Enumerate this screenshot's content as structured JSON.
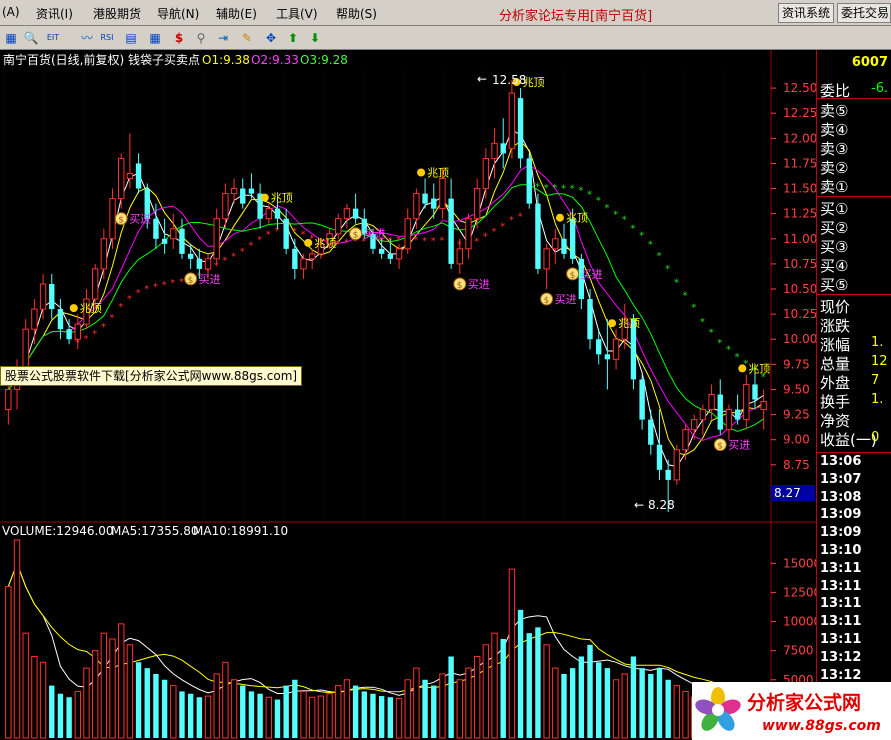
{
  "menu": {
    "items": [
      "(A)",
      "资讯(I)",
      "港股期货",
      "导航(N)",
      "辅助(E)",
      "工具(V)",
      "帮助(S)"
    ],
    "brand": "分析家论坛专用",
    "stock_tag": "[南宁百货]",
    "btn_info": "资讯系统",
    "btn_order": "委托交易"
  },
  "toolbar": {
    "icons": [
      "chart-icon",
      "zoom-icon",
      "eit-icon",
      "wave-icon",
      "rsi-icon",
      "grid-icon",
      "dollar-icon",
      "link-icon",
      "arrow-in-icon",
      "pencil-icon",
      "move-icon",
      "up-arrow-icon",
      "down-arrow-icon"
    ]
  },
  "chart_header": {
    "title": "南宁百货(日线,前复权) 钱袋子买卖点",
    "o1": "O1:9.38",
    "o2": "O2:9.33",
    "o3": "O3:9.28"
  },
  "volume_header": {
    "volume": "VOLUME:12946.00",
    "ma5": "MA5:17355.80",
    "ma10": "MA10:18991.10"
  },
  "annotations": {
    "high": "12.58",
    "low": "8.28",
    "last_price_tag": "8.27",
    "top_label": "兆顶",
    "buy_label": "买进"
  },
  "watermark": "股票公式股票软件下载[分析家公式网www.88gs.com]",
  "right_panel": {
    "code": "6007",
    "wei_bi": "委比",
    "wei_bi_val": "-6.",
    "sells": [
      "卖⑤",
      "卖④",
      "卖③",
      "卖②",
      "卖①"
    ],
    "buys": [
      "买①",
      "买②",
      "买③",
      "买④",
      "买⑤"
    ],
    "stats": [
      {
        "label": "现价",
        "val": ""
      },
      {
        "label": "涨跌",
        "val": ""
      },
      {
        "label": "涨幅",
        "val": "1."
      },
      {
        "label": "总量",
        "val": "12"
      },
      {
        "label": "外盘",
        "val": "7"
      },
      {
        "label": "换手",
        "val": "1."
      },
      {
        "label": "净资",
        "val": ""
      },
      {
        "label": "收益(一)",
        "val": "0"
      }
    ],
    "times": [
      "13:06",
      "13:07",
      "13:08",
      "13:09",
      "13:09",
      "13:10",
      "13:11",
      "13:11",
      "13:11",
      "13:11",
      "13:11",
      "13:12",
      "13:12"
    ]
  },
  "logo": {
    "text": "分析家公式网",
    "url": "www.88gs.com"
  },
  "colors": {
    "up": "#ff3030",
    "down": "#54ffff",
    "ma_white": "#ffffff",
    "ma_yellow": "#ffff00",
    "ma_magenta": "#ff00ff",
    "ma_green": "#00ff00",
    "grid": "#a00000",
    "axis_text": "#ff4040"
  },
  "chart_data": {
    "type": "candlestick",
    "price_axis": {
      "ticks": [
        12.5,
        12.25,
        12.0,
        11.75,
        11.5,
        11.25,
        11.0,
        10.75,
        10.5,
        10.25,
        10.0,
        9.75,
        9.5,
        9.25,
        9.0,
        8.75,
        8.5
      ],
      "ylim": [
        8.35,
        12.7
      ]
    },
    "volume_axis": {
      "ticks": [
        15000,
        12500,
        10000,
        7500,
        5000
      ],
      "ylim": [
        0,
        17000
      ]
    },
    "candles": [
      {
        "o": 9.3,
        "h": 9.6,
        "l": 9.15,
        "c": 9.5,
        "v": 13000
      },
      {
        "o": 9.5,
        "h": 9.8,
        "l": 9.3,
        "c": 9.7,
        "v": 17000
      },
      {
        "o": 9.7,
        "h": 10.2,
        "l": 9.6,
        "c": 10.1,
        "v": 9000
      },
      {
        "o": 10.1,
        "h": 10.4,
        "l": 9.95,
        "c": 10.3,
        "v": 7000
      },
      {
        "o": 10.3,
        "h": 10.65,
        "l": 10.2,
        "c": 10.55,
        "v": 6500
      },
      {
        "o": 10.55,
        "h": 10.65,
        "l": 10.2,
        "c": 10.3,
        "v": 4500
      },
      {
        "o": 10.3,
        "h": 10.4,
        "l": 10.0,
        "c": 10.1,
        "v": 3800
      },
      {
        "o": 10.1,
        "h": 10.2,
        "l": 9.95,
        "c": 10.0,
        "v": 3500
      },
      {
        "o": 10.0,
        "h": 10.25,
        "l": 9.9,
        "c": 10.15,
        "v": 4000
      },
      {
        "o": 10.15,
        "h": 10.5,
        "l": 10.1,
        "c": 10.4,
        "v": 6000
      },
      {
        "o": 10.4,
        "h": 10.75,
        "l": 10.3,
        "c": 10.7,
        "v": 7500
      },
      {
        "o": 10.7,
        "h": 11.1,
        "l": 10.6,
        "c": 11.0,
        "v": 9000
      },
      {
        "o": 11.0,
        "h": 11.5,
        "l": 10.9,
        "c": 11.4,
        "v": 8500
      },
      {
        "o": 11.4,
        "h": 11.85,
        "l": 11.3,
        "c": 11.8,
        "v": 9800
      },
      {
        "o": 11.6,
        "h": 12.05,
        "l": 11.5,
        "c": 11.65,
        "v": 8000
      },
      {
        "o": 11.75,
        "h": 11.85,
        "l": 11.45,
        "c": 11.5,
        "v": 6500
      },
      {
        "o": 11.5,
        "h": 11.55,
        "l": 11.1,
        "c": 11.2,
        "v": 6000
      },
      {
        "o": 11.2,
        "h": 11.35,
        "l": 10.9,
        "c": 11.0,
        "v": 5500
      },
      {
        "o": 11.0,
        "h": 11.2,
        "l": 10.85,
        "c": 10.95,
        "v": 5000
      },
      {
        "o": 11.0,
        "h": 11.25,
        "l": 10.9,
        "c": 11.1,
        "v": 4500
      },
      {
        "o": 11.1,
        "h": 11.2,
        "l": 10.8,
        "c": 10.85,
        "v": 4000
      },
      {
        "o": 10.85,
        "h": 10.95,
        "l": 10.7,
        "c": 10.8,
        "v": 3800
      },
      {
        "o": 10.8,
        "h": 10.9,
        "l": 10.6,
        "c": 10.7,
        "v": 3500
      },
      {
        "o": 10.7,
        "h": 10.85,
        "l": 10.6,
        "c": 10.8,
        "v": 3600
      },
      {
        "o": 10.8,
        "h": 11.3,
        "l": 10.75,
        "c": 11.2,
        "v": 5500
      },
      {
        "o": 11.2,
        "h": 11.55,
        "l": 11.1,
        "c": 11.45,
        "v": 6500
      },
      {
        "o": 11.45,
        "h": 11.6,
        "l": 11.35,
        "c": 11.5,
        "v": 5000
      },
      {
        "o": 11.5,
        "h": 11.6,
        "l": 11.3,
        "c": 11.35,
        "v": 4500
      },
      {
        "o": 11.5,
        "h": 11.65,
        "l": 11.4,
        "c": 11.45,
        "v": 4000
      },
      {
        "o": 11.45,
        "h": 11.55,
        "l": 11.1,
        "c": 11.2,
        "v": 3800
      },
      {
        "o": 11.2,
        "h": 11.35,
        "l": 11.15,
        "c": 11.3,
        "v": 3500
      },
      {
        "o": 11.3,
        "h": 11.4,
        "l": 11.1,
        "c": 11.2,
        "v": 3300
      },
      {
        "o": 11.2,
        "h": 11.3,
        "l": 10.85,
        "c": 10.9,
        "v": 4500
      },
      {
        "o": 10.9,
        "h": 11.0,
        "l": 10.6,
        "c": 10.7,
        "v": 5000
      },
      {
        "o": 10.7,
        "h": 10.85,
        "l": 10.6,
        "c": 10.8,
        "v": 4000
      },
      {
        "o": 10.8,
        "h": 10.9,
        "l": 10.7,
        "c": 10.85,
        "v": 3500
      },
      {
        "o": 10.85,
        "h": 11.0,
        "l": 10.8,
        "c": 10.95,
        "v": 3600
      },
      {
        "o": 10.95,
        "h": 11.1,
        "l": 10.9,
        "c": 11.05,
        "v": 3800
      },
      {
        "o": 11.05,
        "h": 11.25,
        "l": 11.0,
        "c": 11.2,
        "v": 4500
      },
      {
        "o": 11.2,
        "h": 11.35,
        "l": 11.1,
        "c": 11.3,
        "v": 5000
      },
      {
        "o": 11.3,
        "h": 11.45,
        "l": 11.15,
        "c": 11.2,
        "v": 4500
      },
      {
        "o": 11.2,
        "h": 11.3,
        "l": 11.0,
        "c": 11.05,
        "v": 4000
      },
      {
        "o": 11.05,
        "h": 11.1,
        "l": 10.85,
        "c": 10.9,
        "v": 3800
      },
      {
        "o": 10.9,
        "h": 11.0,
        "l": 10.8,
        "c": 10.85,
        "v": 3600
      },
      {
        "o": 10.85,
        "h": 11.0,
        "l": 10.75,
        "c": 10.8,
        "v": 3500
      },
      {
        "o": 10.8,
        "h": 10.95,
        "l": 10.7,
        "c": 10.9,
        "v": 3400
      },
      {
        "o": 10.9,
        "h": 11.3,
        "l": 10.85,
        "c": 11.2,
        "v": 5000
      },
      {
        "o": 11.2,
        "h": 11.5,
        "l": 11.1,
        "c": 11.45,
        "v": 6000
      },
      {
        "o": 11.45,
        "h": 11.6,
        "l": 11.3,
        "c": 11.35,
        "v": 5000
      },
      {
        "o": 11.4,
        "h": 11.55,
        "l": 11.2,
        "c": 11.3,
        "v": 4500
      },
      {
        "o": 11.3,
        "h": 11.7,
        "l": 11.2,
        "c": 11.6,
        "v": 5500
      },
      {
        "o": 11.4,
        "h": 11.6,
        "l": 10.7,
        "c": 10.75,
        "v": 7000
      },
      {
        "o": 10.75,
        "h": 11.0,
        "l": 10.65,
        "c": 10.9,
        "v": 5000
      },
      {
        "o": 10.9,
        "h": 11.25,
        "l": 10.8,
        "c": 11.2,
        "v": 6000
      },
      {
        "o": 11.2,
        "h": 11.6,
        "l": 11.1,
        "c": 11.5,
        "v": 7000
      },
      {
        "o": 11.5,
        "h": 11.9,
        "l": 11.4,
        "c": 11.8,
        "v": 8000
      },
      {
        "o": 11.8,
        "h": 12.1,
        "l": 11.6,
        "c": 11.95,
        "v": 9000
      },
      {
        "o": 11.95,
        "h": 12.2,
        "l": 11.7,
        "c": 11.85,
        "v": 8500
      },
      {
        "o": 11.9,
        "h": 12.58,
        "l": 11.8,
        "c": 12.45,
        "v": 14500
      },
      {
        "o": 12.4,
        "h": 12.5,
        "l": 11.7,
        "c": 11.8,
        "v": 11000
      },
      {
        "o": 11.8,
        "h": 11.85,
        "l": 11.3,
        "c": 11.35,
        "v": 9000
      },
      {
        "o": 11.35,
        "h": 11.45,
        "l": 10.65,
        "c": 10.7,
        "v": 9500
      },
      {
        "o": 10.7,
        "h": 10.95,
        "l": 10.5,
        "c": 10.9,
        "v": 8000
      },
      {
        "o": 10.9,
        "h": 11.1,
        "l": 10.75,
        "c": 11.0,
        "v": 6000
      },
      {
        "o": 11.0,
        "h": 11.15,
        "l": 10.8,
        "c": 10.85,
        "v": 5500
      },
      {
        "o": 11.2,
        "h": 11.3,
        "l": 10.75,
        "c": 10.8,
        "v": 6000
      },
      {
        "o": 10.8,
        "h": 10.85,
        "l": 10.3,
        "c": 10.4,
        "v": 7000
      },
      {
        "o": 10.4,
        "h": 10.5,
        "l": 9.9,
        "c": 10.0,
        "v": 8000
      },
      {
        "o": 10.0,
        "h": 10.1,
        "l": 9.75,
        "c": 9.85,
        "v": 6500
      },
      {
        "o": 9.85,
        "h": 10.2,
        "l": 9.5,
        "c": 9.8,
        "v": 6000
      },
      {
        "o": 9.8,
        "h": 10.1,
        "l": 9.7,
        "c": 10.0,
        "v": 5000
      },
      {
        "o": 10.0,
        "h": 10.35,
        "l": 9.9,
        "c": 10.2,
        "v": 5500
      },
      {
        "o": 10.2,
        "h": 10.25,
        "l": 9.5,
        "c": 9.6,
        "v": 7000
      },
      {
        "o": 9.6,
        "h": 9.65,
        "l": 9.1,
        "c": 9.2,
        "v": 6000
      },
      {
        "o": 9.2,
        "h": 9.3,
        "l": 8.85,
        "c": 8.95,
        "v": 5500
      },
      {
        "o": 8.95,
        "h": 9.3,
        "l": 8.6,
        "c": 8.7,
        "v": 6000
      },
      {
        "o": 8.7,
        "h": 8.8,
        "l": 8.28,
        "c": 8.6,
        "v": 5000
      },
      {
        "o": 8.6,
        "h": 8.95,
        "l": 8.55,
        "c": 8.9,
        "v": 4500
      },
      {
        "o": 8.9,
        "h": 9.15,
        "l": 8.8,
        "c": 9.1,
        "v": 4000
      },
      {
        "o": 9.1,
        "h": 9.25,
        "l": 9.0,
        "c": 9.2,
        "v": 3500
      },
      {
        "o": 9.2,
        "h": 9.35,
        "l": 9.05,
        "c": 9.3,
        "v": 3400
      },
      {
        "o": 9.3,
        "h": 9.55,
        "l": 9.2,
        "c": 9.45,
        "v": 3500
      },
      {
        "o": 9.45,
        "h": 9.6,
        "l": 9.05,
        "c": 9.1,
        "v": 3800
      },
      {
        "o": 9.1,
        "h": 9.35,
        "l": 9.0,
        "c": 9.3,
        "v": 3300
      },
      {
        "o": 9.3,
        "h": 9.45,
        "l": 9.15,
        "c": 9.2,
        "v": 3000
      },
      {
        "o": 9.2,
        "h": 9.65,
        "l": 9.1,
        "c": 9.55,
        "v": 3200
      },
      {
        "o": 9.55,
        "h": 9.75,
        "l": 9.3,
        "c": 9.4,
        "v": 3000
      },
      {
        "o": 9.3,
        "h": 9.5,
        "l": 9.1,
        "c": 9.38,
        "v": 2900
      }
    ],
    "markers_top": [
      8,
      30,
      59,
      70,
      85,
      64,
      88,
      35,
      48
    ],
    "markers_buy": [
      13,
      40,
      21,
      65,
      82,
      88,
      62,
      52
    ]
  }
}
